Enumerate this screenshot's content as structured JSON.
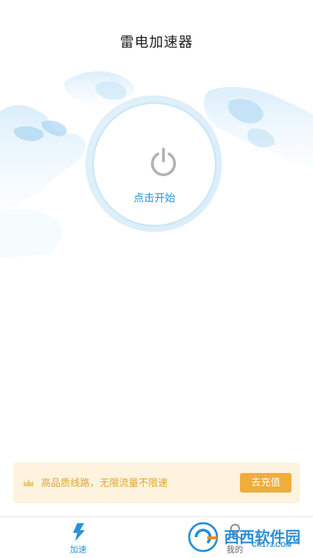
{
  "header": {
    "title": "雷电加速器"
  },
  "main": {
    "start_label": "点击开始",
    "power_icon": "power-icon"
  },
  "promo": {
    "text": "高品质线路，无限流量不限速",
    "button_label": "去充值",
    "icon": "crown-icon",
    "accent_color": "#f0ac3c",
    "background_color": "#fdf3de"
  },
  "tabbar": {
    "items": [
      {
        "label": "加速",
        "icon": "lightning-icon",
        "active": true
      },
      {
        "label": "我的",
        "icon": "user-icon",
        "active": false
      }
    ]
  },
  "watermark": {
    "text": "西西软件园",
    "sub": "CR173.COM"
  },
  "colors": {
    "accent": "#2a93d5"
  }
}
